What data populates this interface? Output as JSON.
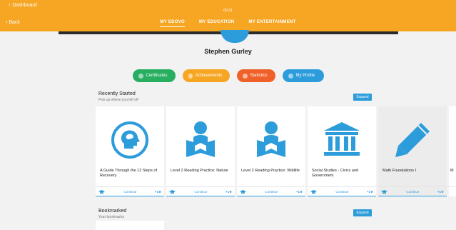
{
  "topbar": {
    "dashboard_label": "Dashboard",
    "time": "00:31",
    "back_label": "Back",
    "tabs": [
      {
        "label": "MY EDOVO",
        "active": true
      },
      {
        "label": "MY EDUCATION",
        "active": false
      },
      {
        "label": "MY ENTERTAINMENT",
        "active": false
      }
    ]
  },
  "profile": {
    "name": "Stephen Gurley"
  },
  "pills": [
    {
      "label": "Certificates",
      "color": "#27ae60"
    },
    {
      "label": "Achievements",
      "color": "#f6a623"
    },
    {
      "label": "Statistics",
      "color": "#f0612a"
    },
    {
      "label": "My Profile",
      "color": "#2d9cdb"
    }
  ],
  "recent": {
    "title": "Recently Started",
    "subtitle": "Pick up where you left off",
    "expand_label": "Expand",
    "cards": [
      {
        "title": "A Guide Through the 12 Steps of Recovery",
        "icon": "head-brain-icon",
        "continue": "Continue",
        "points": "+1★"
      },
      {
        "title": "Level 2 Reading Practice: Nature",
        "icon": "reader-icon",
        "continue": "Continue",
        "points": "+1★"
      },
      {
        "title": "Level 2 Reading Practice: Wildlife",
        "icon": "reader-icon",
        "continue": "Continue",
        "points": "+1★"
      },
      {
        "title": "Social Studies - Civics and Government",
        "icon": "government-building-icon",
        "continue": "Continue",
        "points": "+1★"
      },
      {
        "title": "Math Foundations I",
        "icon": "pencil-icon",
        "continue": "Continue",
        "points": "+1★"
      },
      {
        "title": "M",
        "icon": "",
        "continue": "",
        "points": ""
      }
    ]
  },
  "bookmarked": {
    "title": "Bookmarked",
    "subtitle": "Your bookmarks",
    "expand_label": "Expand"
  },
  "colors": {
    "accent": "#f6a623",
    "blue": "#2d9cdb"
  }
}
